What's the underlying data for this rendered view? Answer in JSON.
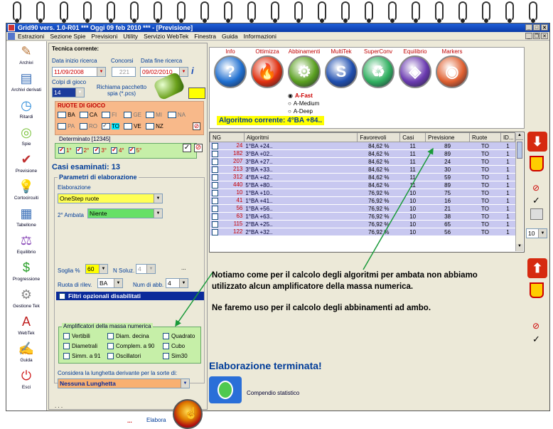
{
  "window": {
    "title": "Grid90 vers. 1.0-R01   ***  Oggi 09 feb 2010   ***   - [Previsione]"
  },
  "menu": [
    "Estrazioni",
    "Sezione Spie",
    "Previsioni",
    "Utility",
    "Servizio WebTek",
    "Finestra",
    "Guida",
    "Informazioni"
  ],
  "sidebar": [
    {
      "label": "Archivi",
      "icon": "pencil-icon"
    },
    {
      "label": "Archivi derivati",
      "icon": "database-icon"
    },
    {
      "label": "Ritardi",
      "icon": "clock-icon"
    },
    {
      "label": "Spie",
      "icon": "binoculars-icon"
    },
    {
      "label": "Previsione",
      "icon": "checklist-icon"
    },
    {
      "label": "Cortocircuiti",
      "icon": "lightbulb-icon"
    },
    {
      "label": "Tabellone",
      "icon": "calendar-icon"
    },
    {
      "label": "Equilibrio",
      "icon": "scale-icon"
    },
    {
      "label": "Progressione",
      "icon": "dollar-icon"
    },
    {
      "label": "Gestione Tek",
      "icon": "tools-icon"
    },
    {
      "label": "WebTek",
      "icon": "webtek-icon"
    },
    {
      "label": "Guida",
      "icon": "guide-icon"
    },
    {
      "label": "Esci",
      "icon": "exit-icon"
    }
  ],
  "left": {
    "section_title": "Tecnica corrente:",
    "data_inizio_label": "Data inizio ricerca",
    "data_inizio": "11/09/2008",
    "concorsi_label": "Concorsi",
    "concorsi": "221",
    "data_fine_label": "Data fine ricerca",
    "data_fine": "09/02/2010",
    "colpi_label": "Colpi di gioco",
    "colpi": "14",
    "richiama_label": "Richiama pacchetto spia (*.pcs)",
    "ruote_title": "RUOTE DI GIOCO",
    "ruote_row1": [
      "BA",
      "CA",
      "FI",
      "GE",
      "MI",
      "NA"
    ],
    "ruote_row2": [
      "PA",
      "RO",
      "TO",
      "VE",
      "NZ"
    ],
    "determinato_label": "Determinato [12345]",
    "determinato": [
      "1°",
      "2°",
      "3°",
      "4°",
      "5°"
    ],
    "casi_esaminati": "Casi esaminati: 13",
    "params_title": "Parametri di elaborazione",
    "elaborazione_label": "Elaborazione",
    "elaborazione": "OneStep ruote",
    "ambata_label": "2° Ambata",
    "ambata": "Niente",
    "soglia_label": "Soglia %",
    "soglia": "60",
    "nsoluz_label": "N Soluz.",
    "nsoluz": "4",
    "ellipsis": "...",
    "ruota_rilev_label": "Ruota di rilev.",
    "ruota_rilev": "BA",
    "num_abb_label": "Num di abb.",
    "num_abb": "4",
    "filtri": "Filtri opzionali disabilitati",
    "amp_title": "Amplificatori della massa numerica",
    "amp": [
      "Vertibili",
      "Diam. decina",
      "Quadrato",
      "Diametrali",
      "Complem. a 90",
      "Cubo",
      "Simm. a 91",
      "Oscillatori",
      "Sim30"
    ],
    "lunghetta_label": "Considera la lunghetta derivante per la sorte di:",
    "lunghetta": "Nessuna Lunghetta",
    "dots1": ". . .",
    "dots2": "...",
    "elabora": "Elabora"
  },
  "top": {
    "buttons": [
      "Info",
      "Ottimizza",
      "Abbinamenti",
      "MultiTek",
      "SuperConv",
      "Equilibrio",
      "Markers"
    ],
    "radios": [
      "A-Fast",
      "A-Medium",
      "A-Deep"
    ],
    "algoritmo": "Algoritmo corrente: 4°BA +84.."
  },
  "grid": {
    "headers": [
      "NG",
      "Algoritmi",
      "Favorevoli",
      "Casi",
      "Previsione",
      "Ruote",
      "ID..."
    ],
    "rows": [
      [
        "24",
        "1°BA +24..",
        "84,62 %",
        "11",
        "89",
        "TO",
        "1"
      ],
      [
        "182",
        "3°BA +02..",
        "84,62 %",
        "11",
        "89",
        "TO",
        "1"
      ],
      [
        "207",
        "3°BA +27..",
        "84,62 %",
        "11",
        "24",
        "TO",
        "1"
      ],
      [
        "213",
        "3°BA +33..",
        "84,62 %",
        "11",
        "30",
        "TO",
        "1"
      ],
      [
        "312",
        "4°BA +42..",
        "84,62 %",
        "11",
        "59",
        "TO",
        "1"
      ],
      [
        "440",
        "5°BA +80..",
        "84,62 %",
        "11",
        "89",
        "TO",
        "1"
      ],
      [
        "10",
        "1°BA +10..",
        "76,92 %",
        "10",
        "75",
        "TO",
        "1"
      ],
      [
        "41",
        "1°BA +41..",
        "76,92 %",
        "10",
        "16",
        "TO",
        "1"
      ],
      [
        "56",
        "1°BA +56..",
        "76,92 %",
        "10",
        "21",
        "TO",
        "1"
      ],
      [
        "63",
        "1°BA +63..",
        "76,92 %",
        "10",
        "38",
        "TO",
        "1"
      ],
      [
        "115",
        "2°BA +25..",
        "76,92 %",
        "10",
        "65",
        "TO",
        "1"
      ],
      [
        "122",
        "2°BA +32..",
        "76,92 %",
        "10",
        "56",
        "TO",
        "1"
      ]
    ]
  },
  "right": {
    "count": "10"
  },
  "note": {
    "line1": "Notiamo come per il calcolo degli algoritmi per ambata non abbiamo",
    "line2": "utilizzato alcun amplificatore della massa numerica.",
    "line3": "Ne faremo uso per il calcolo degli abbinamenti ad ambo."
  },
  "bottom": {
    "elab_done": "Elaborazione terminata!",
    "compendio": "Compendio statistico"
  }
}
